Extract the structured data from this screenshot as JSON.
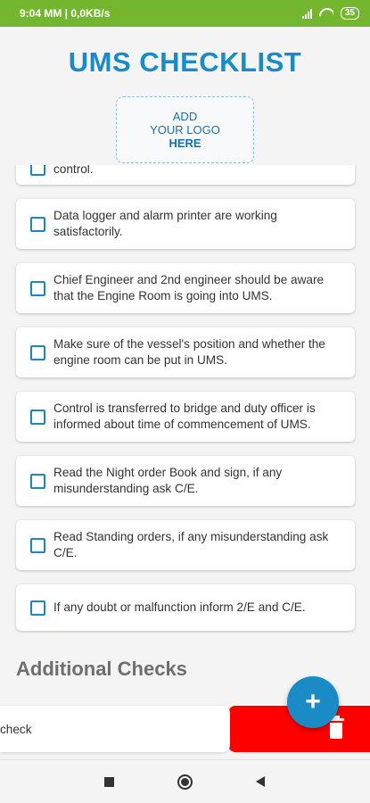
{
  "status_bar": {
    "time_info": "9:04 MM | 0,0KB/s",
    "battery": "35"
  },
  "header": {
    "title": "UMS CHECKLIST"
  },
  "logo": {
    "line1": "ADD",
    "line2": "YOUR LOGO",
    "line3": "HERE"
  },
  "checklist": [
    "control.",
    "Data logger and alarm printer are working satisfactorily.",
    "Chief Engineer and 2nd engineer should be aware that the Engine Room is going into UMS.",
    "Make sure of the vessel's position and whether the engine room can be put in UMS.",
    "Control is transferred to bridge and duty officer is informed about time of commencement of UMS.",
    "Read the Night order Book and sign, if any misunderstanding ask C/E.",
    "Read Standing orders, if any misunderstanding ask C/E.",
    "If any doubt or malfunction inform 2/E and C/E."
  ],
  "additional": {
    "heading": "Additional Checks",
    "item_partial": "check"
  },
  "fab": {
    "label": "+"
  }
}
